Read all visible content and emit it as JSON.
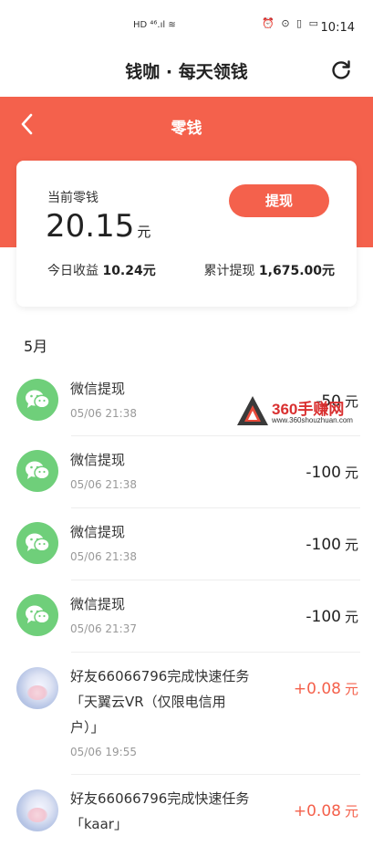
{
  "status_bar": {
    "left_icons": "HD ⁴⁶.ıl ≋",
    "right_icons": "⏰ ⊙ ▯ ▭",
    "time": "10:14"
  },
  "header": {
    "app_title": "钱咖 · 每天领钱"
  },
  "page": {
    "title": "零钱"
  },
  "balance": {
    "label": "当前零钱",
    "amount": "20.15",
    "unit": "元",
    "withdraw_button": "提现",
    "today_label": "今日收益",
    "today_value": "10.24元",
    "total_label": "累计提现",
    "total_value": "1,675.00元"
  },
  "list": {
    "month": "5月",
    "items": [
      {
        "title": "微信提现",
        "time": "05/06 21:38",
        "amount": "-50",
        "unit": "元"
      },
      {
        "title": "微信提现",
        "time": "05/06 21:38",
        "amount": "-100",
        "unit": "元"
      },
      {
        "title": "微信提现",
        "time": "05/06 21:38",
        "amount": "-100",
        "unit": "元"
      },
      {
        "title": "微信提现",
        "time": "05/06 21:37",
        "amount": "-100",
        "unit": "元"
      },
      {
        "title_line1": "好友66066796完成快速任务",
        "title_line2": "「天翼云VR（仅限电信用",
        "title_line3": "户）」",
        "time": "05/06 19:55",
        "amount": "+0.08",
        "unit": "元"
      },
      {
        "title_line1": "好友66066796完成快速任务",
        "title_line2": "「kaar」",
        "amount": "+0.08",
        "unit": "元"
      }
    ]
  },
  "watermark": {
    "text": "360手赚网",
    "url": "www.360shouzhuan.com"
  },
  "colors": {
    "accent": "#f4614c",
    "wechat": "#6fcf7a"
  }
}
